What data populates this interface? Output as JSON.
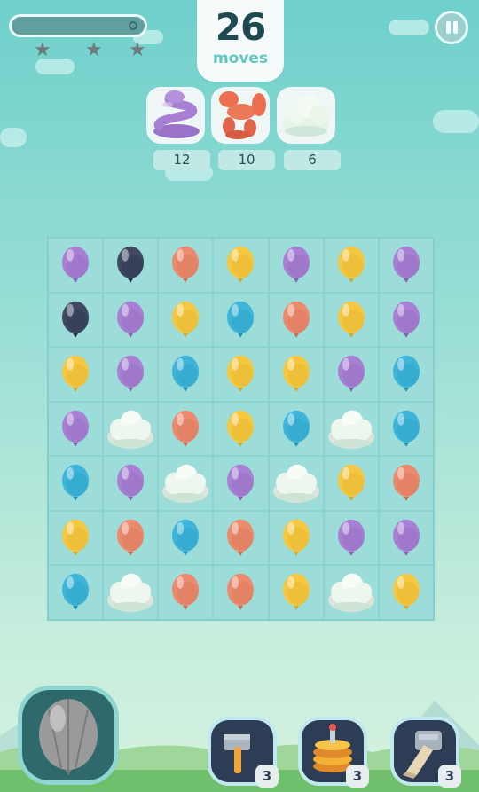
{
  "moves": {
    "count": "26",
    "label": "moves"
  },
  "progress": {
    "fill_fraction": 0.0,
    "stars_earned": 0,
    "stars_total": 3
  },
  "goals": [
    {
      "name": "purple-snake-balloon",
      "count": "12"
    },
    {
      "name": "red-balloon-animal",
      "count": "10"
    },
    {
      "name": "cloud",
      "count": "6"
    }
  ],
  "board": [
    [
      "purple",
      "navy",
      "orange",
      "yellow",
      "purple",
      "yellow",
      "purple"
    ],
    [
      "navy",
      "purple",
      "yellow",
      "blue",
      "orange",
      "yellow",
      "purple"
    ],
    [
      "yellow",
      "purple",
      "blue",
      "yellow",
      "yellow",
      "purple",
      "blue"
    ],
    [
      "purple",
      "cloud",
      "orange",
      "yellow",
      "blue",
      "cloud",
      "blue"
    ],
    [
      "blue",
      "purple",
      "cloud",
      "purple",
      "cloud",
      "yellow",
      "orange"
    ],
    [
      "yellow",
      "orange",
      "blue",
      "orange",
      "yellow",
      "purple",
      "purple"
    ],
    [
      "blue",
      "cloud",
      "orange",
      "orange",
      "yellow",
      "cloud",
      "yellow"
    ]
  ],
  "colors": {
    "purple": "#a77fd3",
    "navy": "#3f4a62",
    "orange": "#ec8a6e",
    "yellow": "#f6c842",
    "blue": "#3fb4d9",
    "cloud": "#eef7ee"
  },
  "boosters": [
    {
      "name": "hammer-booster",
      "count": "3"
    },
    {
      "name": "pancake-stack-booster",
      "count": "3"
    },
    {
      "name": "cannon-booster",
      "count": "3"
    }
  ]
}
